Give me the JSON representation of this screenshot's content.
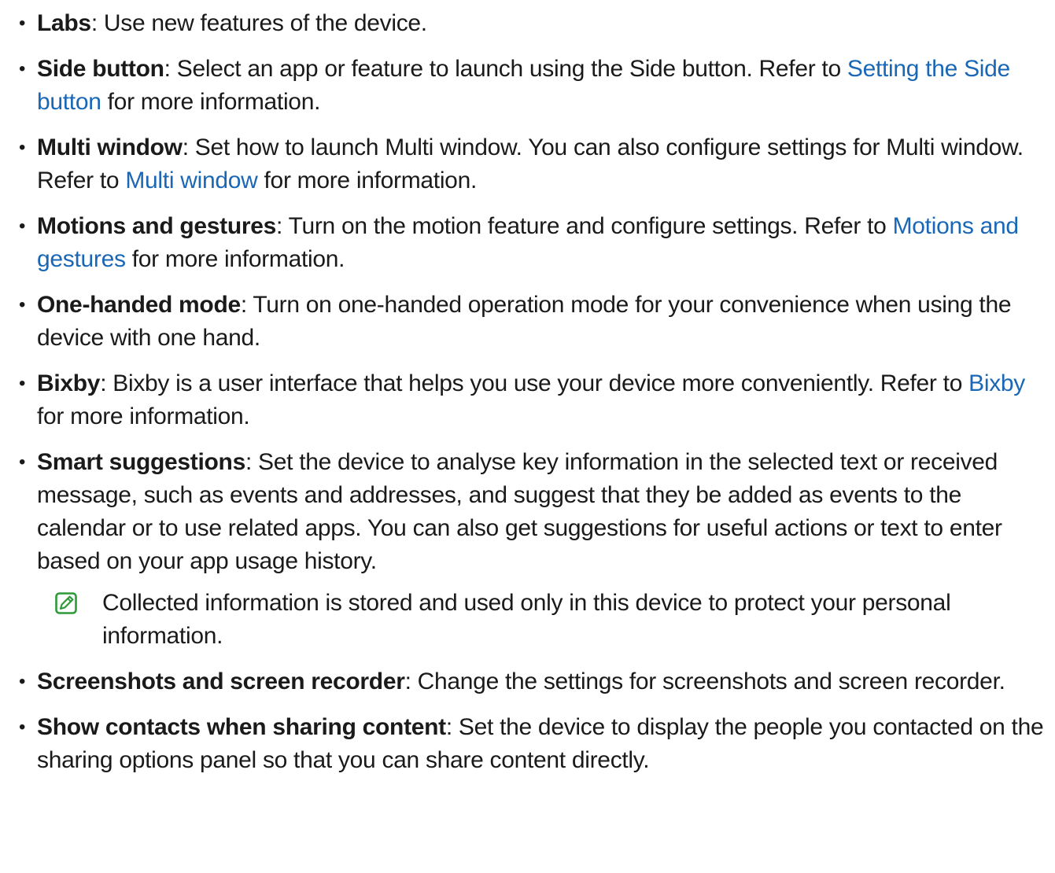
{
  "items": [
    {
      "term": "Labs",
      "desc": ": Use new features of the device.",
      "link": "",
      "after": ""
    },
    {
      "term": "Side button",
      "desc": ": Select an app or feature to launch using the Side button. Refer to ",
      "link": "Setting the Side button",
      "after": " for more information."
    },
    {
      "term": "Multi window",
      "desc": ": Set how to launch Multi window. You can also configure settings for Multi window. Refer to ",
      "link": "Multi window",
      "after": " for more information."
    },
    {
      "term": "Motions and gestures",
      "desc": ": Turn on the motion feature and configure settings. Refer to ",
      "link": "Motions and gestures",
      "after": " for more information."
    },
    {
      "term": "One-handed mode",
      "desc": ": Turn on one-handed operation mode for your convenience when using the device with one hand.",
      "link": "",
      "after": ""
    },
    {
      "term": "Bixby",
      "desc": ": Bixby is a user interface that helps you use your device more conveniently. Refer to ",
      "link": "Bixby",
      "after": " for more information."
    },
    {
      "term": "Smart suggestions",
      "desc": ": Set the device to analyse key information in the selected text or received message, such as events and addresses, and suggest that they be added as events to the calendar or to use related apps. You can also get suggestions for useful actions or text to enter based on your app usage history.",
      "link": "",
      "after": "",
      "note": "Collected information is stored and used only in this device to protect your personal information."
    },
    {
      "term": "Screenshots and screen recorder",
      "desc": ": Change the settings for screenshots and screen recorder.",
      "link": "",
      "after": ""
    },
    {
      "term": "Show contacts when sharing content",
      "desc": ": Set the device to display the people you contacted on the sharing options panel so that you can share content directly.",
      "link": "",
      "after": ""
    }
  ],
  "bullet_symbol": "•",
  "colors": {
    "text": "#1a1a1a",
    "link": "#1a67b6",
    "note_icon": "#2e9a38"
  },
  "icons": {
    "note": "note-pencil-icon"
  }
}
